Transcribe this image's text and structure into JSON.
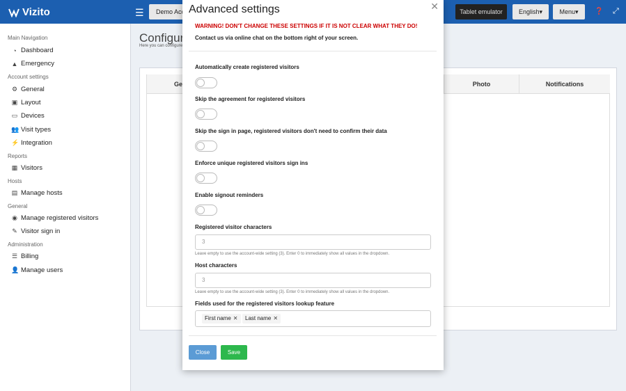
{
  "topbar": {
    "brand": "Vizito",
    "account_button": "Demo Account",
    "tablet_button": "Tablet emulator",
    "language_button": "English",
    "menu_button": "Menu",
    "colors": {
      "bar": "#1c5fb0"
    }
  },
  "sidebar": {
    "sections": [
      {
        "header": "Main Navigation",
        "items": [
          {
            "label": "Dashboard",
            "icon": "dashboard-icon"
          },
          {
            "label": "Emergency",
            "icon": "warning-icon"
          }
        ]
      },
      {
        "header": "Account settings",
        "items": [
          {
            "label": "General",
            "icon": "gear-icon"
          },
          {
            "label": "Layout",
            "icon": "image-icon"
          },
          {
            "label": "Devices",
            "icon": "tablet-icon"
          },
          {
            "label": "Visit types",
            "icon": "users-icon"
          },
          {
            "label": "Integration",
            "icon": "plug-icon"
          }
        ]
      },
      {
        "header": "Reports",
        "items": [
          {
            "label": "Visitors",
            "icon": "table-icon"
          }
        ]
      },
      {
        "header": "Hosts",
        "items": [
          {
            "label": "Manage hosts",
            "icon": "building-icon"
          }
        ]
      },
      {
        "header": "General",
        "items": [
          {
            "label": "Manage registered visitors",
            "icon": "circle-icon"
          },
          {
            "label": "Visitor sign in",
            "icon": "pencil-icon"
          }
        ]
      },
      {
        "header": "Administration",
        "items": [
          {
            "label": "Billing",
            "icon": "list-icon"
          },
          {
            "label": "Manage users",
            "icon": "user-plus-icon"
          }
        ]
      }
    ]
  },
  "background": {
    "title": "Configure",
    "subtitle": "Here you can configure",
    "columns": [
      "Ge",
      "Photo",
      "Notifications"
    ]
  },
  "modal": {
    "title": "Advanced settings",
    "warning": "WARNING! DON'T CHANGE THESE SETTINGS IF IT IS NOT CLEAR WHAT THEY DO!",
    "contact": "Contact us via online chat on the bottom right of your screen.",
    "toggles": [
      {
        "label": "Automatically create registered visitors",
        "on": false
      },
      {
        "label": "Skip the agreement for registered visitors",
        "on": false
      },
      {
        "label": "Skip the sign in page, registered visitors don't need to confirm their data",
        "on": false
      },
      {
        "label": "Enforce unique registered visitors sign ins",
        "on": false
      },
      {
        "label": "Enable signout reminders",
        "on": false
      }
    ],
    "registered_visitor_characters": {
      "label": "Registered visitor characters",
      "placeholder": "3",
      "help": "Leave empty to use the account-wide setting (3). Enter 0 to immediately show all values in the dropdown."
    },
    "host_characters": {
      "label": "Host characters",
      "placeholder": "3",
      "help": "Leave empty to use the account-wide setting (3). Enter 0 to immediately show all values in the dropdown."
    },
    "lookup_fields": {
      "label": "Fields used for the registered visitors lookup feature",
      "tags": [
        "First name",
        "Last name"
      ]
    },
    "close_button": "Close",
    "save_button": "Save",
    "colors": {
      "warning": "#cc0000",
      "close": "#5b9bd5",
      "save": "#2db84d"
    }
  }
}
